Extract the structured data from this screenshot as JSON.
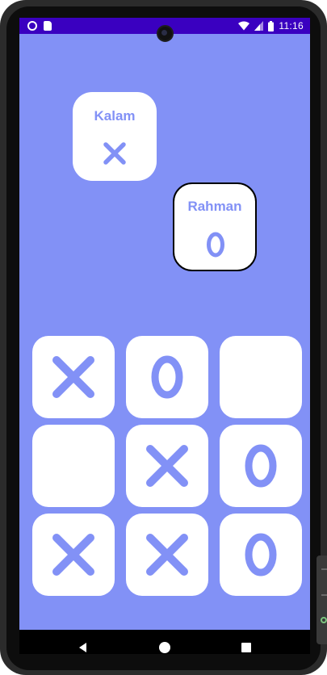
{
  "status_bar": {
    "time": "11:16",
    "left_icons": [
      "circle-notification-icon",
      "sd-card-icon"
    ],
    "right_icons": [
      "wifi-icon",
      "cellular-signal-icon",
      "battery-icon"
    ],
    "color": "#3a00c0"
  },
  "theme": {
    "background": "#8291f6",
    "card": "#ffffff",
    "accent": "#8291f6"
  },
  "players": [
    {
      "name": "Kalam",
      "symbol": "X",
      "active": false
    },
    {
      "name": "Rahman",
      "symbol": "O",
      "active": true
    }
  ],
  "board": {
    "cells": [
      "X",
      "O",
      "",
      "",
      "X",
      "O",
      "X",
      "X",
      "O"
    ]
  },
  "nav_bar": {
    "buttons": [
      "back-icon",
      "home-icon",
      "recents-icon"
    ]
  }
}
